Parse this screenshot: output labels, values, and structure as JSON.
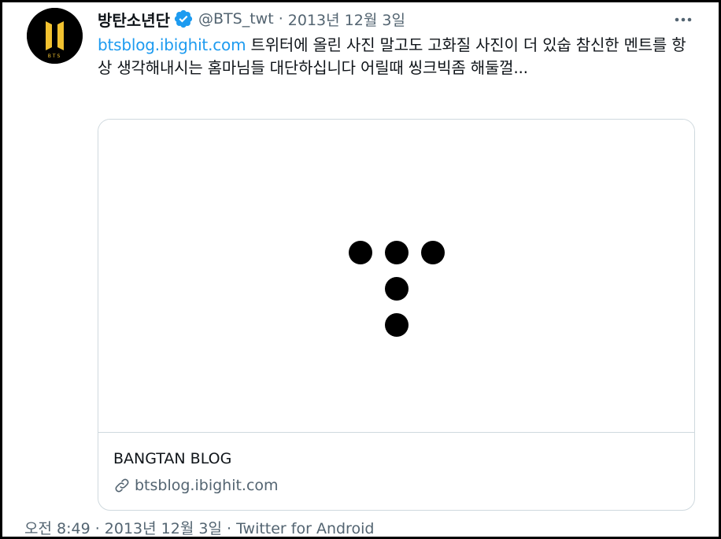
{
  "tweet": {
    "avatar_icon": "bts-logo-icon",
    "avatar_label": "BTS",
    "display_name": "방탄소년단",
    "verified_icon": "verified-badge-icon",
    "handle": "@BTS_twt",
    "separator": "·",
    "date": "2013년 12월 3일",
    "more_icon": "more-options-icon",
    "text": {
      "link": "btsblog.ibighit.com",
      "body": " 트위터에 올린 사진 말고도 고화질 사진이 더 있숩 참신한 멘트를 항상 생각해내시는 홈마님들 대단하십니다 어릴때 씽크빅좀 해둘껄..."
    },
    "card": {
      "media_icon": "bighit-logo-icon",
      "title": "BANGTAN BLOG",
      "link_icon": "link-icon",
      "domain": "btsblog.ibighit.com"
    },
    "footer": {
      "time": "오전 8:49",
      "separator1": " · ",
      "date": "2013년 12월 3일",
      "separator2": " · ",
      "source": "Twitter for Android"
    }
  },
  "colors": {
    "accent": "#1d9bf0",
    "muted": "#536471",
    "border": "#cfd9de",
    "avatar_gold": "#f2c230"
  }
}
